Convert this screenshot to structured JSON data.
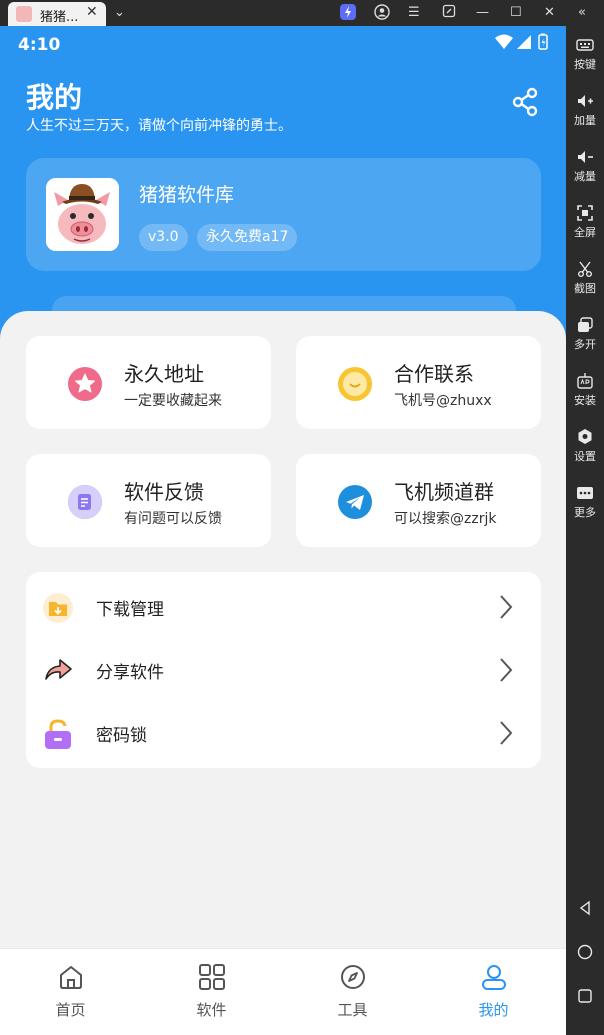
{
  "window": {
    "tab_title": "猪猪...",
    "tab_close": "✕",
    "dropdown": "⌄"
  },
  "sidebar": {
    "items": [
      {
        "label": "按键",
        "icon": "keyboard-icon"
      },
      {
        "label": "加量",
        "icon": "volume-up-icon"
      },
      {
        "label": "减量",
        "icon": "volume-down-icon"
      },
      {
        "label": "全屏",
        "icon": "fullscreen-icon"
      },
      {
        "label": "截图",
        "icon": "scissors-icon"
      },
      {
        "label": "多开",
        "icon": "multi-instance-icon"
      },
      {
        "label": "安装",
        "icon": "apk-icon"
      },
      {
        "label": "设置",
        "icon": "gear-icon"
      },
      {
        "label": "更多",
        "icon": "more-icon"
      }
    ]
  },
  "status_bar": {
    "time": "4:10"
  },
  "header": {
    "title": "我的",
    "subtitle": "人生不过三万天，请做个向前冲锋的勇士。"
  },
  "app_card": {
    "name": "猪猪软件库",
    "version": "v3.0",
    "license": "永久免费a17"
  },
  "tiles": [
    {
      "title": "永久地址",
      "subtitle": "一定要收藏起来",
      "icon": "star-icon",
      "color": "#f06a8c"
    },
    {
      "title": "合作联系",
      "subtitle": "飞机号@zhuxx",
      "icon": "smile-icon",
      "color": "#f7c531"
    },
    {
      "title": "软件反馈",
      "subtitle": "有问题可以反馈",
      "icon": "feedback-icon",
      "color": "#8d78f0"
    },
    {
      "title": "飞机频道群",
      "subtitle": "可以搜索@zzrjk",
      "icon": "telegram-icon",
      "color": "#1e8fdc"
    }
  ],
  "menu": [
    {
      "label": "下载管理",
      "icon": "download-folder-icon"
    },
    {
      "label": "分享软件",
      "icon": "share-arrow-icon"
    },
    {
      "label": "密码锁",
      "icon": "lock-icon"
    }
  ],
  "bottom_nav": [
    {
      "label": "首页",
      "icon": "home-icon"
    },
    {
      "label": "软件",
      "icon": "grid-icon"
    },
    {
      "label": "工具",
      "icon": "compass-icon"
    },
    {
      "label": "我的",
      "icon": "user-icon",
      "active": true
    }
  ],
  "colors": {
    "brand_blue": "#2a95f0",
    "background": "#f2f2f2"
  }
}
